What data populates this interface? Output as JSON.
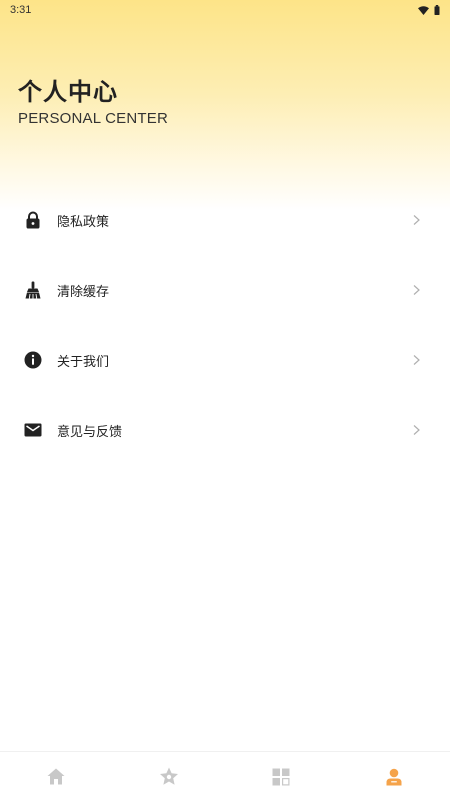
{
  "status_bar": {
    "time": "3:31",
    "icons": [
      "wifi-icon",
      "battery-icon"
    ]
  },
  "header": {
    "title": "个人中心",
    "subtitle": "PERSONAL CENTER"
  },
  "menu": {
    "items": [
      {
        "label": "隐私政策",
        "icon": "lock-icon"
      },
      {
        "label": "清除缓存",
        "icon": "broom-icon"
      },
      {
        "label": "关于我们",
        "icon": "info-icon"
      },
      {
        "label": "意见与反馈",
        "icon": "mail-icon"
      }
    ]
  },
  "tabbar": {
    "tabs": [
      {
        "icon": "home-icon",
        "active": false
      },
      {
        "icon": "star-icon",
        "active": false
      },
      {
        "icon": "grid-icon",
        "active": false
      },
      {
        "icon": "user-icon",
        "active": true
      }
    ]
  },
  "colors": {
    "header_gradient_top": "#fde488",
    "active_tab": "#f5a34a",
    "inactive_tab": "#c8c8c8",
    "menu_icon": "#222222",
    "chevron": "#b0b0b0"
  }
}
